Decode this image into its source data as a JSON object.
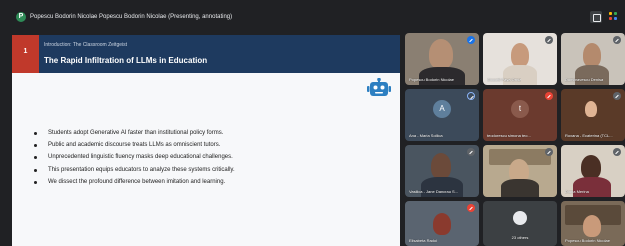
{
  "presenter": {
    "initial": "P",
    "label": "Popescu Bodorin Nicolae Popescu Bodorin Nicolae (Presenting, annotating)"
  },
  "slide": {
    "number": "1",
    "subtitle": "Introduction: The Classroom Zeitgeist",
    "title": "The Rapid Infiltration of LLMs in Education",
    "bullets": [
      "Students adopt Generative AI faster than institutional policy forms.",
      "Public and academic discourse treats LLMs as omniscient tutors.",
      "Unprecedented linguistic fluency masks deep educational challenges.",
      "This presentation equips educators to analyze these systems critically.",
      "We dissect the profound difference between imitation and learning."
    ],
    "colors": {
      "header": "#1e3a5f",
      "accent": "#c0392b",
      "robot": "#2d7fc1"
    }
  },
  "participants": [
    {
      "name": "Popescu Bodorin Nicolae",
      "initial": "",
      "icon": "more-options-icon"
    },
    {
      "name": "Ciocotti Paya Ornia",
      "initial": "",
      "icon": "mic-off-icon"
    },
    {
      "name": "Dumbravescu Denisa",
      "initial": "",
      "icon": "mic-off-icon"
    },
    {
      "name": "Ana - Maria Sollica",
      "initial": "A",
      "icon": "speaking-icon"
    },
    {
      "name": "teodorescu simona teo...",
      "initial": "t",
      "icon": "mic-off-icon"
    },
    {
      "name": "Roxana - Ecaterina (TCL...",
      "initial": "",
      "icon": "mic-off-icon"
    },
    {
      "name": "Vasilica - Jane Dancrau S...",
      "initial": "",
      "icon": "mic-off-icon"
    },
    {
      "name": "",
      "initial": "",
      "icon": "mic-off-icon"
    },
    {
      "name": "Diana Merina",
      "initial": "",
      "icon": "mic-off-icon"
    },
    {
      "name": "Elisabeta Radoi",
      "initial": "",
      "icon": "mic-off-icon"
    },
    {
      "name": "23 others",
      "initial": "",
      "icon": ""
    },
    {
      "name": "Popescu Bodorin Nicolae",
      "initial": "",
      "icon": ""
    }
  ]
}
